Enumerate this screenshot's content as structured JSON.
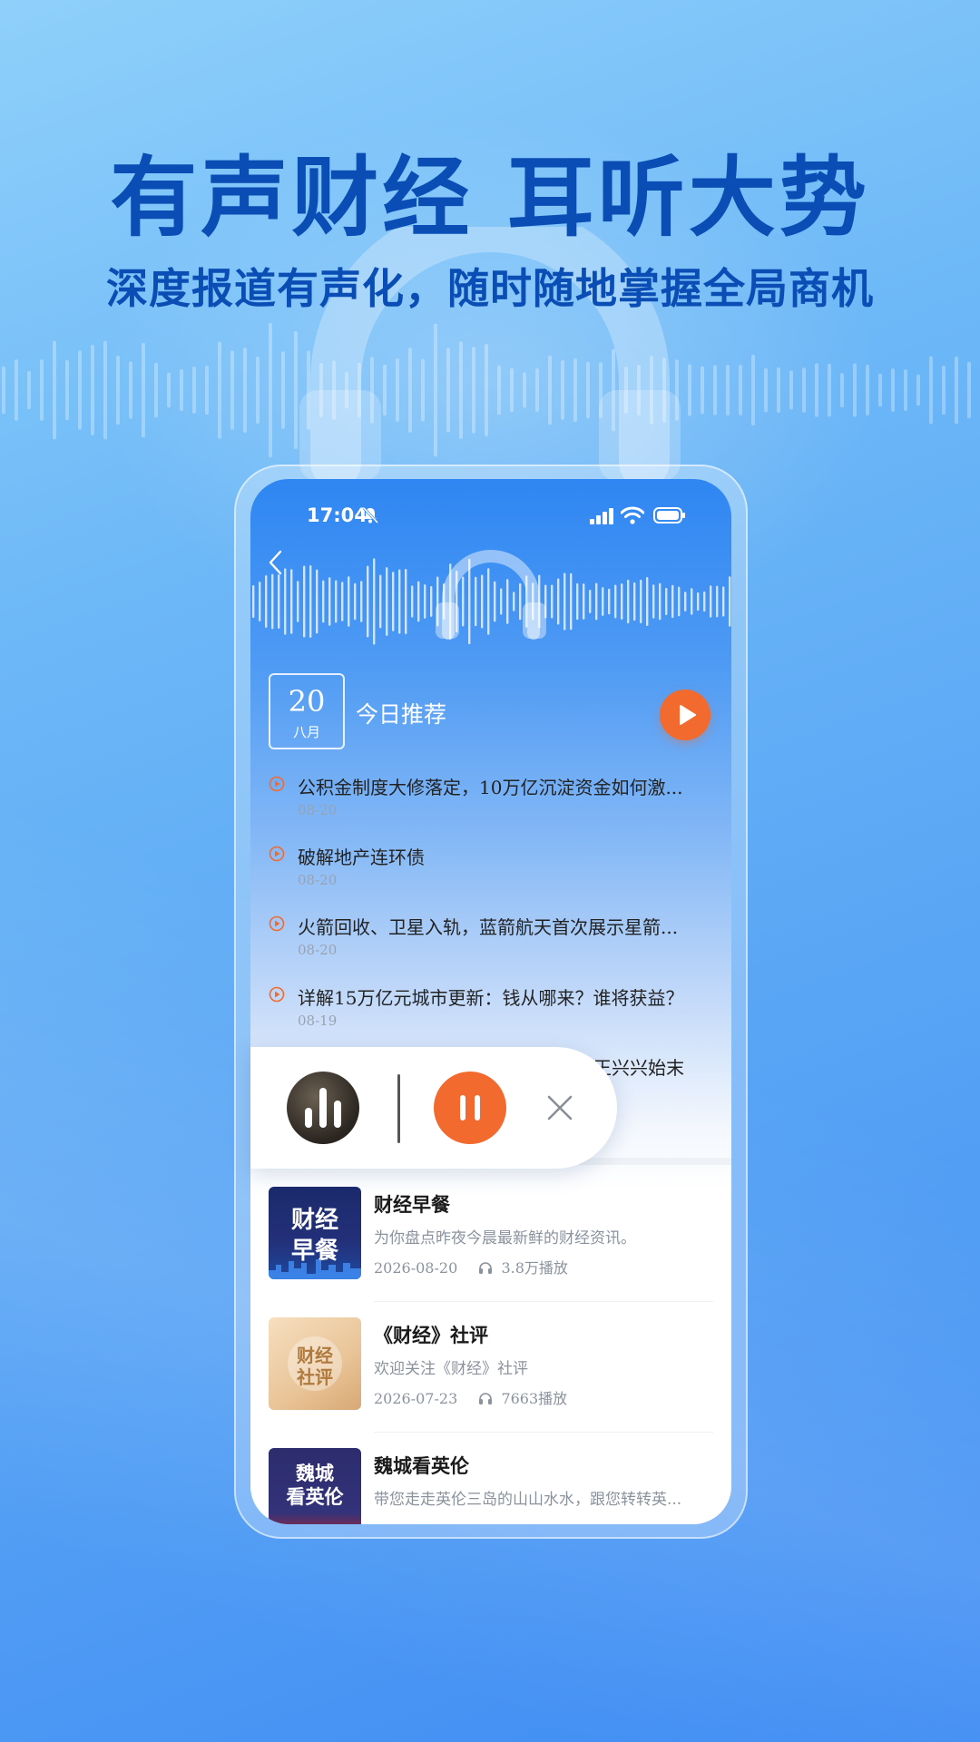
{
  "promo": {
    "headline": "有声财经 耳听大势",
    "subline": "深度报道有声化，随时随地掌握全局商机"
  },
  "status_bar": {
    "time": "17:04",
    "icons": [
      "bell-muted-icon",
      "signal-icon",
      "wifi-icon",
      "battery-icon"
    ]
  },
  "header": {
    "back_icon": "chevron-left-icon",
    "date_day": "20",
    "date_month": "八月",
    "title": "今日推荐",
    "play_icon": "play-icon"
  },
  "recommendations": [
    {
      "title": "公积金制度大修落定，10万亿沉淀资金如何激...",
      "date": "08-20"
    },
    {
      "title": "破解地产连环债",
      "date": "08-20"
    },
    {
      "title": "火箭回收、卫星入轨，蓝箭航天首次展示星箭...",
      "date": "08-20"
    },
    {
      "title": "详解15万亿元城市更新：钱从哪来？谁将获益？",
      "date": "08-19"
    },
    {
      "title": "王兴兴始末",
      "date": ""
    }
  ],
  "mini_player": {
    "state": "playing",
    "icons": [
      "audio-bars-icon",
      "pause-icon",
      "close-icon"
    ]
  },
  "albums": [
    {
      "title": "财经早餐",
      "desc": "为你盘点昨夜今晨最新鲜的财经资讯。",
      "date": "2026-08-20",
      "plays": "3.8万播放",
      "cover_line1": "财经",
      "cover_line2": "早餐"
    },
    {
      "title": "《财经》社评",
      "desc": "欢迎关注《财经》社评",
      "date": "2026-07-23",
      "plays": "7663播放",
      "cover_line1": "财经",
      "cover_line2": "社评"
    },
    {
      "title": "魏城看英伦",
      "desc": "带您走走英伦三岛的山山水水，跟您转转英...",
      "date": "",
      "plays": "",
      "cover_line1": "魏城",
      "cover_line2": "看英伦"
    }
  ],
  "colors": {
    "brand_blue": "#0a4db4",
    "accent_orange": "#f26a2e"
  }
}
